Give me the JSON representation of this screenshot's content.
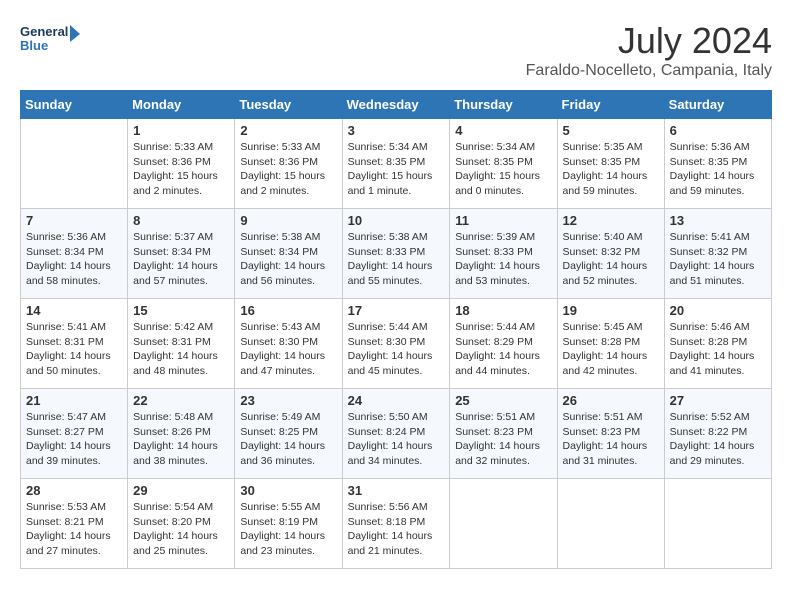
{
  "header": {
    "logo_line1": "General",
    "logo_line2": "Blue",
    "month_year": "July 2024",
    "location": "Faraldo-Nocelleto, Campania, Italy"
  },
  "days_of_week": [
    "Sunday",
    "Monday",
    "Tuesday",
    "Wednesday",
    "Thursday",
    "Friday",
    "Saturday"
  ],
  "weeks": [
    [
      {
        "day": "",
        "content": ""
      },
      {
        "day": "1",
        "content": "Sunrise: 5:33 AM\nSunset: 8:36 PM\nDaylight: 15 hours\nand 2 minutes."
      },
      {
        "day": "2",
        "content": "Sunrise: 5:33 AM\nSunset: 8:36 PM\nDaylight: 15 hours\nand 2 minutes."
      },
      {
        "day": "3",
        "content": "Sunrise: 5:34 AM\nSunset: 8:35 PM\nDaylight: 15 hours\nand 1 minute."
      },
      {
        "day": "4",
        "content": "Sunrise: 5:34 AM\nSunset: 8:35 PM\nDaylight: 15 hours\nand 0 minutes."
      },
      {
        "day": "5",
        "content": "Sunrise: 5:35 AM\nSunset: 8:35 PM\nDaylight: 14 hours\nand 59 minutes."
      },
      {
        "day": "6",
        "content": "Sunrise: 5:36 AM\nSunset: 8:35 PM\nDaylight: 14 hours\nand 59 minutes."
      }
    ],
    [
      {
        "day": "7",
        "content": "Sunrise: 5:36 AM\nSunset: 8:34 PM\nDaylight: 14 hours\nand 58 minutes."
      },
      {
        "day": "8",
        "content": "Sunrise: 5:37 AM\nSunset: 8:34 PM\nDaylight: 14 hours\nand 57 minutes."
      },
      {
        "day": "9",
        "content": "Sunrise: 5:38 AM\nSunset: 8:34 PM\nDaylight: 14 hours\nand 56 minutes."
      },
      {
        "day": "10",
        "content": "Sunrise: 5:38 AM\nSunset: 8:33 PM\nDaylight: 14 hours\nand 55 minutes."
      },
      {
        "day": "11",
        "content": "Sunrise: 5:39 AM\nSunset: 8:33 PM\nDaylight: 14 hours\nand 53 minutes."
      },
      {
        "day": "12",
        "content": "Sunrise: 5:40 AM\nSunset: 8:32 PM\nDaylight: 14 hours\nand 52 minutes."
      },
      {
        "day": "13",
        "content": "Sunrise: 5:41 AM\nSunset: 8:32 PM\nDaylight: 14 hours\nand 51 minutes."
      }
    ],
    [
      {
        "day": "14",
        "content": "Sunrise: 5:41 AM\nSunset: 8:31 PM\nDaylight: 14 hours\nand 50 minutes."
      },
      {
        "day": "15",
        "content": "Sunrise: 5:42 AM\nSunset: 8:31 PM\nDaylight: 14 hours\nand 48 minutes."
      },
      {
        "day": "16",
        "content": "Sunrise: 5:43 AM\nSunset: 8:30 PM\nDaylight: 14 hours\nand 47 minutes."
      },
      {
        "day": "17",
        "content": "Sunrise: 5:44 AM\nSunset: 8:30 PM\nDaylight: 14 hours\nand 45 minutes."
      },
      {
        "day": "18",
        "content": "Sunrise: 5:44 AM\nSunset: 8:29 PM\nDaylight: 14 hours\nand 44 minutes."
      },
      {
        "day": "19",
        "content": "Sunrise: 5:45 AM\nSunset: 8:28 PM\nDaylight: 14 hours\nand 42 minutes."
      },
      {
        "day": "20",
        "content": "Sunrise: 5:46 AM\nSunset: 8:28 PM\nDaylight: 14 hours\nand 41 minutes."
      }
    ],
    [
      {
        "day": "21",
        "content": "Sunrise: 5:47 AM\nSunset: 8:27 PM\nDaylight: 14 hours\nand 39 minutes."
      },
      {
        "day": "22",
        "content": "Sunrise: 5:48 AM\nSunset: 8:26 PM\nDaylight: 14 hours\nand 38 minutes."
      },
      {
        "day": "23",
        "content": "Sunrise: 5:49 AM\nSunset: 8:25 PM\nDaylight: 14 hours\nand 36 minutes."
      },
      {
        "day": "24",
        "content": "Sunrise: 5:50 AM\nSunset: 8:24 PM\nDaylight: 14 hours\nand 34 minutes."
      },
      {
        "day": "25",
        "content": "Sunrise: 5:51 AM\nSunset: 8:23 PM\nDaylight: 14 hours\nand 32 minutes."
      },
      {
        "day": "26",
        "content": "Sunrise: 5:51 AM\nSunset: 8:23 PM\nDaylight: 14 hours\nand 31 minutes."
      },
      {
        "day": "27",
        "content": "Sunrise: 5:52 AM\nSunset: 8:22 PM\nDaylight: 14 hours\nand 29 minutes."
      }
    ],
    [
      {
        "day": "28",
        "content": "Sunrise: 5:53 AM\nSunset: 8:21 PM\nDaylight: 14 hours\nand 27 minutes."
      },
      {
        "day": "29",
        "content": "Sunrise: 5:54 AM\nSunset: 8:20 PM\nDaylight: 14 hours\nand 25 minutes."
      },
      {
        "day": "30",
        "content": "Sunrise: 5:55 AM\nSunset: 8:19 PM\nDaylight: 14 hours\nand 23 minutes."
      },
      {
        "day": "31",
        "content": "Sunrise: 5:56 AM\nSunset: 8:18 PM\nDaylight: 14 hours\nand 21 minutes."
      },
      {
        "day": "",
        "content": ""
      },
      {
        "day": "",
        "content": ""
      },
      {
        "day": "",
        "content": ""
      }
    ]
  ]
}
